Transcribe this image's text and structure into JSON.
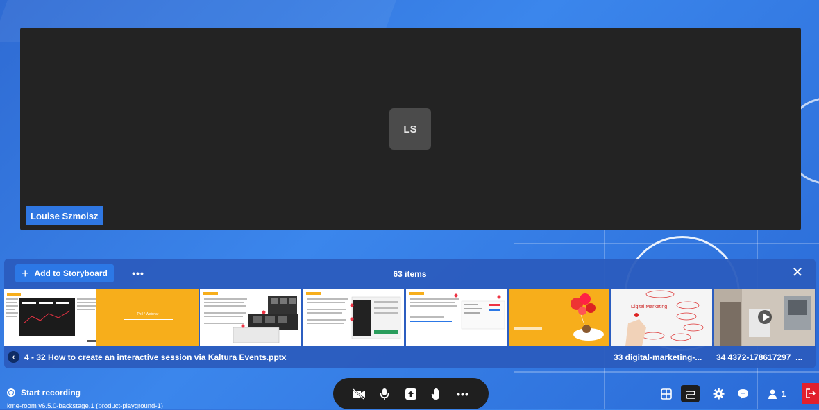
{
  "participant": {
    "initials": "LS",
    "name": "Louise Szmoisz"
  },
  "storyboard": {
    "add_label": "Add to Storyboard",
    "more_label": "•••",
    "items_count": "63 items",
    "close_label": "✕",
    "thumbnails": [
      {
        "kind": "slide-dark-table"
      },
      {
        "kind": "slide-orange-title",
        "text": "Poll / Webinar"
      },
      {
        "kind": "slide-screens"
      },
      {
        "kind": "slide-form"
      },
      {
        "kind": "slide-list"
      },
      {
        "kind": "image-balloons"
      },
      {
        "kind": "image-digital-marketing",
        "text": "Digital Marketing"
      },
      {
        "kind": "video-lab"
      }
    ],
    "caption_main": "4 - 32 How to create an interactive session via Kaltura Events.pptx",
    "caption_item_33": "33 digital-marketing-...",
    "caption_item_34": "34 4372-178617297_..."
  },
  "footer": {
    "record_label": "Start recording",
    "version_text": "kme-room v6.5.0-backstage.1 (product-playground-1)",
    "participants_count": "1"
  },
  "colors": {
    "background": "#3b86ec",
    "stage": "#232323",
    "name_tag": "#2f77e2",
    "panel": "#2b5cbe",
    "leave": "#e1202c",
    "accent_orange": "#f7ae1b"
  }
}
